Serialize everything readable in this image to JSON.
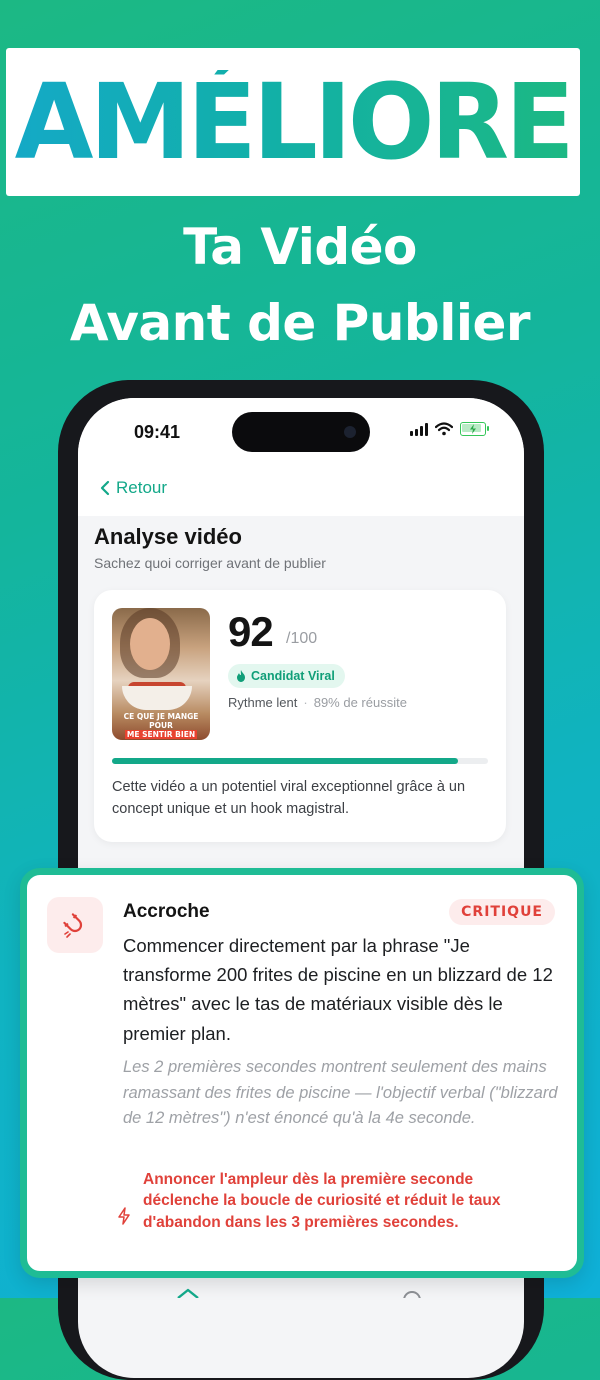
{
  "hero": {
    "headline": "AMÉLIORE",
    "line1": "Ta Vidéo",
    "line2": "Avant de Publier"
  },
  "status_bar": {
    "time": "09:41",
    "icons": [
      "cellular-signal-icon",
      "wifi-icon",
      "battery-charging-icon"
    ]
  },
  "nav": {
    "back_label": "Retour",
    "back_icon": "chevron-left-icon"
  },
  "page": {
    "title": "Analyse vidéo",
    "subtitle": "Sachez quoi corriger avant de publier"
  },
  "score_card": {
    "thumbnail_caption_line1": "CE QUE JE MANGE",
    "thumbnail_caption_line2": "POUR",
    "thumbnail_caption_line3": "ME SENTIR BIEN",
    "score": "92",
    "score_max": "/100",
    "badge_icon": "flame-icon",
    "badge_label": "Candidat Viral",
    "meta_pace": "Rythme lent",
    "meta_separator": "·",
    "meta_success": "89% de réussite",
    "progress_fraction": 0.92,
    "description": "Cette vidéo a un potentiel viral exceptionnel grâce à un concept unique et un hook magistral."
  },
  "feedback_card": {
    "icon": "magnet-icon",
    "title": "Accroche",
    "severity": "CRITIQUE",
    "suggestion": "Commencer directement par la phrase \"Je transforme 200 frites de piscine en un blizzard de 12 mètres\" avec le tas de matériaux visible dès le premier plan.",
    "observation": "Les 2 premières secondes montrent seulement des mains ramassant des frites de piscine — l'objectif verbal (\"blizzard de 12 mètres\") n'est énoncé qu'à la 4e seconde.",
    "impact_icon": "lightning-icon",
    "impact": "Annoncer l'ampleur dès la première seconde déclenche la boucle de curiosité et réduit le taux d'abandon dans les 3 premières secondes."
  },
  "colors": {
    "accent": "#13a889",
    "critical": "#e0413a",
    "card_border": "#1fbc95"
  }
}
